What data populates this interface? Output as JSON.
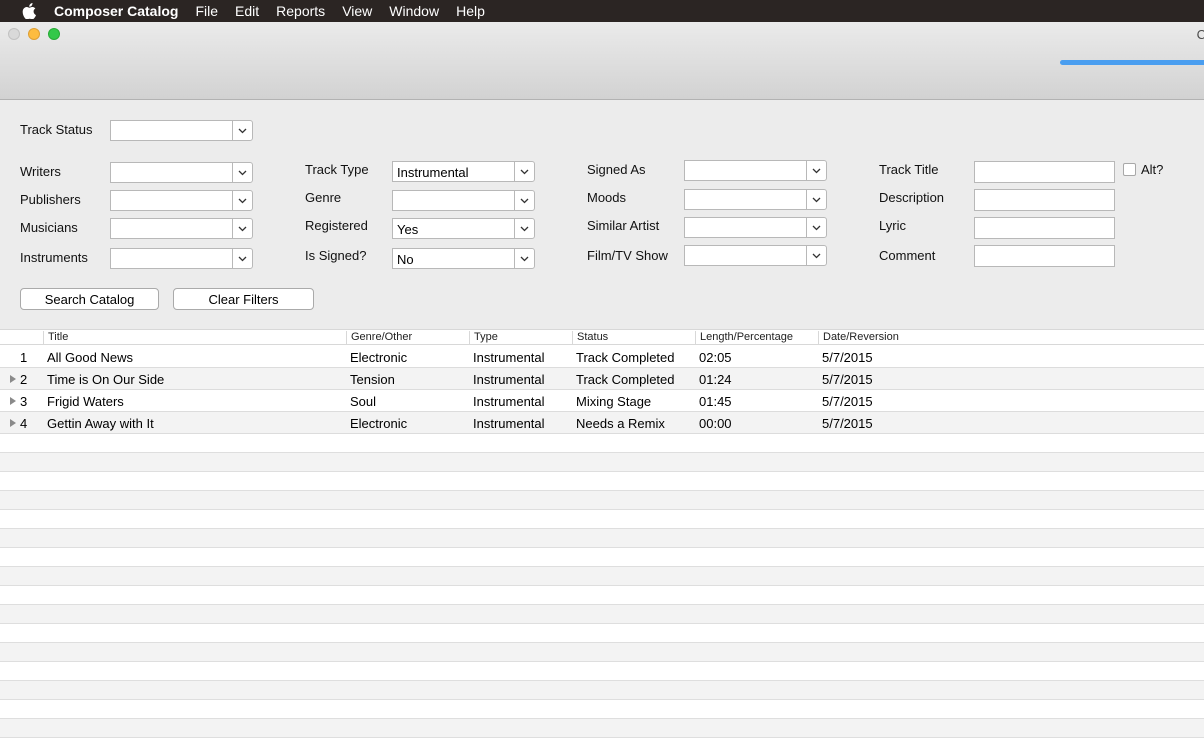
{
  "menubar": {
    "app_name": "Composer Catalog",
    "items": [
      "File",
      "Edit",
      "Reports",
      "View",
      "Window",
      "Help"
    ]
  },
  "window": {
    "title_fragment": "C",
    "progress": 0.9
  },
  "filters": {
    "track_status": {
      "label": "Track Status",
      "value": ""
    },
    "writers": {
      "label": "Writers",
      "value": ""
    },
    "publishers": {
      "label": "Publishers",
      "value": ""
    },
    "musicians": {
      "label": "Musicians",
      "value": ""
    },
    "instruments": {
      "label": "Instruments",
      "value": ""
    },
    "track_type": {
      "label": "Track Type",
      "value": "Instrumental"
    },
    "genre": {
      "label": "Genre",
      "value": ""
    },
    "registered": {
      "label": "Registered",
      "value": "Yes"
    },
    "is_signed": {
      "label": "Is Signed?",
      "value": "No"
    },
    "signed_as": {
      "label": "Signed As",
      "value": ""
    },
    "moods": {
      "label": "Moods",
      "value": ""
    },
    "similar_artist": {
      "label": "Similar Artist",
      "value": ""
    },
    "film_tv_show": {
      "label": "Film/TV Show",
      "value": ""
    },
    "track_title": {
      "label": "Track Title",
      "value": ""
    },
    "alt": {
      "label": "Alt?",
      "checked": false
    },
    "description": {
      "label": "Description",
      "value": ""
    },
    "lyric": {
      "label": "Lyric",
      "value": ""
    },
    "comment": {
      "label": "Comment",
      "value": ""
    },
    "search_button": "Search Catalog",
    "clear_button": "Clear Filters"
  },
  "table": {
    "columns": [
      "Title",
      "Genre/Other",
      "Type",
      "Status",
      "Length/Percentage",
      "Date/Reversion"
    ],
    "rows": [
      {
        "num": "1",
        "expandable": false,
        "title": "All Good News",
        "genre": "Electronic",
        "type": "Instrumental",
        "status": "Track Completed",
        "length": "02:05",
        "date": "5/7/2015"
      },
      {
        "num": "2",
        "expandable": true,
        "title": "Time is On Our Side",
        "genre": "Tension",
        "type": "Instrumental",
        "status": "Track Completed",
        "length": "01:24",
        "date": "5/7/2015"
      },
      {
        "num": "3",
        "expandable": true,
        "title": "Frigid Waters",
        "genre": "Soul",
        "type": "Instrumental",
        "status": "Mixing Stage",
        "length": "01:45",
        "date": "5/7/2015"
      },
      {
        "num": "4",
        "expandable": true,
        "title": "Gettin Away with It",
        "genre": "Electronic",
        "type": "Instrumental",
        "status": "Needs a Remix",
        "length": "00:00",
        "date": "5/7/2015"
      }
    ]
  },
  "colors": {
    "menubar_bg": "#2b2523",
    "progress": "#4a9ef0",
    "close": "#d9d9d9",
    "minimize": "#fdbc40",
    "zoom": "#34c84a"
  }
}
